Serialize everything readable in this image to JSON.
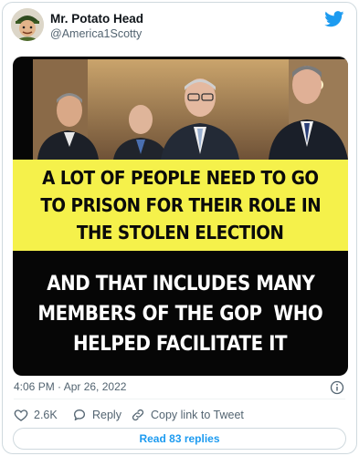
{
  "author": {
    "display_name": "Mr. Potato Head",
    "handle": "@America1Scotty",
    "avatar_icon": "avatar-cartoon-icon"
  },
  "logo_icon": "twitter-bird-icon",
  "media": {
    "yellow_text": [
      "A LOT OF PEOPLE NEED TO GO",
      "TO PRISON FOR THEIR ROLE IN",
      "THE STOLEN ELECTION"
    ],
    "black_text": [
      "AND THAT INCLUDES MANY",
      "MEMBERS OF THE GOP  WHO",
      "HELPED FACILITATE IT"
    ],
    "colors": {
      "banner_yellow": "#f5f14b",
      "banner_black": "#060606"
    }
  },
  "timestamp": "4:06 PM · Apr 26, 2022",
  "actions": {
    "likes": "2.6K",
    "reply_label": "Reply",
    "copy_link_label": "Copy link to Tweet"
  },
  "read_replies_label": "Read 83 replies",
  "colors": {
    "accent": "#1d9bf0",
    "muted": "#536471",
    "like_icon": "#536471"
  }
}
